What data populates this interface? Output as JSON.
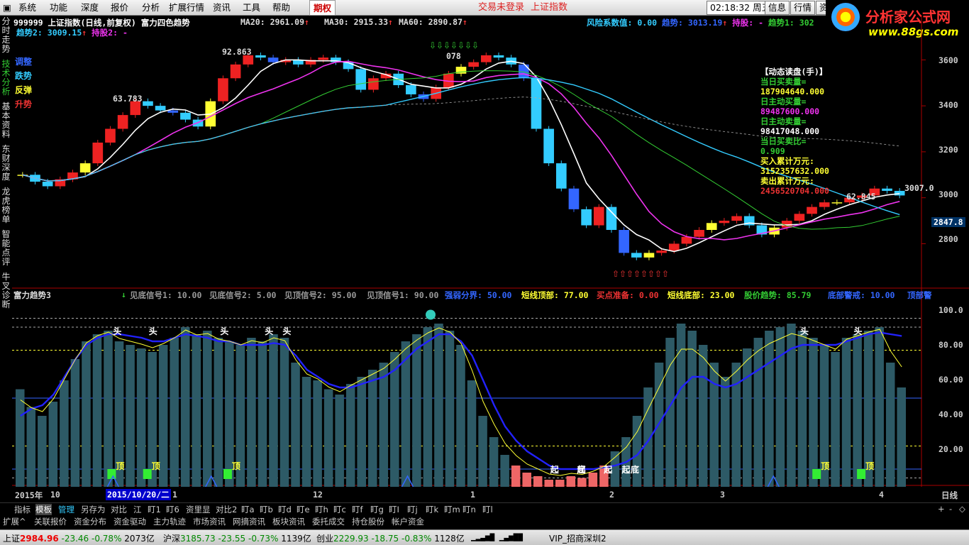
{
  "menu": {
    "items": [
      "系统",
      "功能",
      "深度",
      "报价",
      "分析",
      "扩展行情",
      "资讯",
      "工具",
      "帮助"
    ],
    "active": "期权",
    "status1": "交易未登录",
    "status2": "上证指数",
    "time": "02:18:32",
    "time_suffix": "周五",
    "btn_info": "信息",
    "btn_quote": "行情",
    "btn_cut": "资"
  },
  "logo": {
    "title": "分析家公式网",
    "url": "www.88gs.com"
  },
  "leftnav": [
    "分时走势",
    "技术分析",
    "基本资料",
    "东财深度",
    "龙虎榜单",
    "智能点评",
    "牛叉诊断"
  ],
  "chart_header": {
    "code": "999999",
    "name": "上证指数(日线,前复权)",
    "formula": "富力四色趋势",
    "ma20_label": "MA20:",
    "ma20": "2961.09",
    "ma30_label": "MA30:",
    "ma30": "2915.33",
    "ma60_label": "MA60:",
    "ma60": "2890.87",
    "risk_label": "风险系数值:",
    "risk": "0.00",
    "trend_label": "趋势:",
    "trend": "3013.19",
    "hold_label": "持股:",
    "hold": "-",
    "trend1_label": "趋势1:",
    "trend1": "302",
    "trend2_label": "趋势2:",
    "trend2": "3009.15",
    "hold2_label": "持股2:",
    "hold2": "-"
  },
  "legend": {
    "l1": "调整",
    "l2": "跌势",
    "l3": "反弹",
    "l4": "升势"
  },
  "price_marks": {
    "m1": "92.863",
    "m2": "63.783",
    "m3": "078",
    "m4": "62.845",
    "m5": "3007.0",
    "current": "2847.8"
  },
  "price_axis": [
    "3600",
    "3400",
    "3200",
    "3000",
    "2800"
  ],
  "dynamic": {
    "title": "【动态读盘(手)】",
    "r1l": "当日买卖量=",
    "r1v": "187904640.000",
    "r2l": "日主动买量=",
    "r2v": "89487600.000",
    "r3l": "日主动卖量=",
    "r3v": "98417048.000",
    "r4l": "当日买卖比=",
    "r4v": "0.909",
    "r5l": "买入累计万元:",
    "r5v": "3152357632.000",
    "r6l": "卖出累计万元:",
    "r6v": "2456520704.000"
  },
  "sub_header": {
    "name": "富力趋势3",
    "s1": "见底信号1: 10.00",
    "s2": "见底信号2: 5.00",
    "s3": "见顶信号2: 95.00",
    "s4": "见顶信号1: 90.00",
    "s5": "强弱分界: 50.00",
    "s6": "短线顶部: 77.00",
    "s7": "买点准备: 0.00",
    "s8": "短线底部: 23.00",
    "s9": "股价趋势: 85.79",
    "s10": "底部警戒: 10.00",
    "s11": "顶部警"
  },
  "sub_axis": [
    "100.0",
    "80.00",
    "60.00",
    "40.00",
    "20.00"
  ],
  "xaxis": {
    "y2015": "2015年",
    "m10": "10",
    "cursor": "2015/10/20/二",
    "m11": "1",
    "m12": "12",
    "m1": "1",
    "m2": "2",
    "m3": "3",
    "m4": "4",
    "period": "日线"
  },
  "bottom_tabs": [
    "指标",
    "模板",
    "管理",
    "另存为",
    "对比",
    "江",
    "盯1",
    "盯6",
    "资里显",
    "对比2",
    "盯a",
    "盯b",
    "盯d",
    "盯e",
    "盯h",
    "盯c",
    "盯f",
    "盯g",
    "盯I",
    "盯j",
    "盯k",
    "盯m",
    "盯n",
    "盯l"
  ],
  "bottom_tabs2": [
    "扩展^",
    "关联报价",
    "资金分布",
    "资金驱动",
    "主力轨迹",
    "市场资讯",
    "网摘资讯",
    "板块资讯",
    "委托成交",
    "持仓股份",
    "帐户资金"
  ],
  "zoom": {
    "plus": "+",
    "minus": "-",
    "dots": "◇"
  },
  "status": {
    "sh": "上证",
    "sh_v": "2984.96",
    "sh_c": "-23.46",
    "sh_p": "-0.78%",
    "sh_a": "2073亿",
    "hs": "沪深",
    "hs_v": "3185.73",
    "hs_c": "-23.55",
    "hs_p": "-0.73%",
    "hs_a": "1139亿",
    "cy": "创业",
    "cy_v": "2229.93",
    "cy_c": "-18.75",
    "cy_p": "-0.83%",
    "cy_a": "1128亿",
    "vip": "VIP_招商深圳2"
  },
  "sub_labels": {
    "tou": "头",
    "ding": "顶",
    "qi": "起",
    "di": "底",
    "hai": "底"
  },
  "sub_markers": {
    "tou": [
      0.11,
      0.15,
      0.23,
      0.28,
      0.3,
      0.88,
      0.94
    ],
    "ding": [
      0.11,
      0.15,
      0.24,
      0.9,
      0.95
    ],
    "qi": [
      0.6,
      0.63,
      0.66,
      0.68
    ],
    "di": [
      0.69
    ],
    "hai": [
      0.63
    ],
    "fan": [
      0.11,
      0.22,
      0.44,
      0.85
    ]
  },
  "chart_data": [
    {
      "type": "candlestick",
      "title": "上证指数(日线,前复权)",
      "y_ticks": [
        3600,
        3400,
        3200,
        3000,
        2800
      ],
      "ylim": [
        2650,
        3700
      ],
      "x_ticks": [
        "2015年",
        "10",
        "1",
        "12",
        "1",
        "2",
        "3",
        "4"
      ],
      "close": [
        3100,
        3070,
        3050,
        3080,
        3110,
        3150,
        3240,
        3300,
        3360,
        3420,
        3400,
        3380,
        3370,
        3340,
        3310,
        3420,
        3520,
        3580,
        3620,
        3610,
        3590,
        3600,
        3580,
        3600,
        3610,
        3590,
        3560,
        3470,
        3520,
        3540,
        3490,
        3450,
        3430,
        3480,
        3540,
        3570,
        3590,
        3620,
        3610,
        3580,
        3520,
        3300,
        3150,
        3040,
        2950,
        2880,
        2960,
        2860,
        2760,
        2740,
        2760,
        2770,
        2800,
        2830,
        2860,
        2890,
        2900,
        2920,
        2880,
        2840,
        2870,
        2900,
        2930,
        2960,
        2980,
        2980,
        3000,
        3010,
        3040,
        3030,
        3010
      ],
      "series": [
        {
          "name": "MA20",
          "value": 2961.09
        },
        {
          "name": "MA30",
          "value": 2915.33
        },
        {
          "name": "MA60",
          "value": 2890.87
        }
      ]
    },
    {
      "type": "bar+line",
      "title": "富力趋势3",
      "y_ticks": [
        100,
        80,
        60,
        40,
        20
      ],
      "ylim": [
        0,
        100
      ],
      "lines": {
        "见底信号1": 10,
        "见底信号2": 5,
        "见顶信号2": 95,
        "见顶信号1": 90,
        "强弱分界": 50,
        "短线顶部": 77,
        "短线底部": 23,
        "股价趋势": 85.79,
        "底部警戒": 10
      },
      "bars": [
        55,
        45,
        40,
        48,
        60,
        72,
        82,
        86,
        88,
        82,
        80,
        78,
        76,
        80,
        84,
        90,
        86,
        88,
        84,
        82,
        80,
        84,
        82,
        86,
        84,
        70,
        62,
        60,
        55,
        52,
        58,
        62,
        66,
        70,
        76,
        82,
        86,
        90,
        92,
        88,
        80,
        60,
        40,
        28,
        18,
        12,
        8,
        6,
        4,
        4,
        6,
        5,
        8,
        12,
        20,
        28,
        40,
        56,
        70,
        84,
        92,
        88,
        80,
        70,
        62,
        70,
        78,
        84,
        88,
        90,
        92,
        88,
        84,
        80,
        76,
        84,
        86,
        88,
        90,
        70,
        56
      ],
      "trend": [
        40,
        44,
        46,
        52,
        62,
        72,
        80,
        84,
        86,
        86,
        85,
        84,
        82,
        82,
        84,
        86,
        85,
        84,
        82,
        82,
        80,
        80,
        80,
        81,
        80,
        74,
        66,
        62,
        58,
        56,
        56,
        58,
        60,
        62,
        66,
        72,
        78,
        82,
        86,
        86,
        82,
        74,
        60,
        46,
        34,
        26,
        20,
        16,
        12,
        10,
        10,
        10,
        10,
        11,
        12,
        14,
        18,
        26,
        36,
        46,
        56,
        62,
        62,
        58,
        56,
        58,
        62,
        66,
        70,
        74,
        78,
        80,
        80,
        80,
        80,
        82,
        84,
        86,
        87,
        86,
        85
      ]
    }
  ]
}
